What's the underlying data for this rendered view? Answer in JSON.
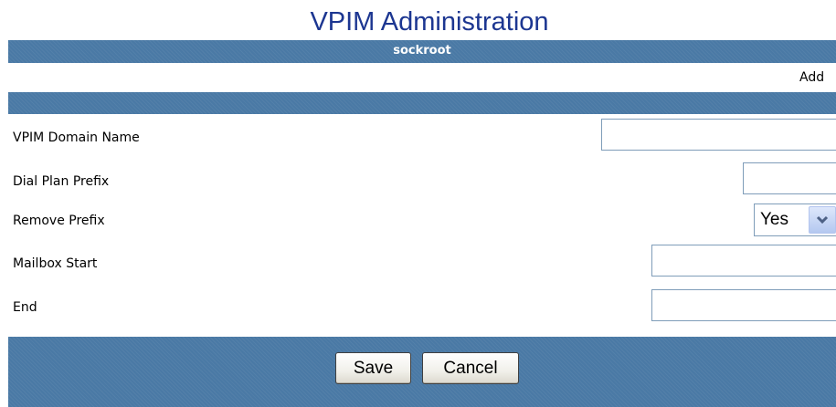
{
  "page": {
    "title": "VPIM Administration"
  },
  "header": {
    "username": "sockroot"
  },
  "subheader": {
    "mode_text": "Add"
  },
  "form": {
    "vpim_domain_name": {
      "label": "VPIM Domain Name",
      "value": ""
    },
    "dial_plan_prefix": {
      "label": "Dial Plan Prefix",
      "value": ""
    },
    "remove_prefix": {
      "label": "Remove Prefix",
      "value": "Yes"
    },
    "mailbox_start": {
      "label": "Mailbox Start",
      "value": ""
    },
    "end": {
      "label": "End",
      "value": ""
    }
  },
  "actions": {
    "save_label": "Save",
    "cancel_label": "Cancel"
  },
  "colors": {
    "title": "#1c3691",
    "band": "#4a79a5",
    "select_arrow_bg": "#c5d5f5"
  },
  "icons": {
    "select_arrow": "chevron-down-icon"
  }
}
